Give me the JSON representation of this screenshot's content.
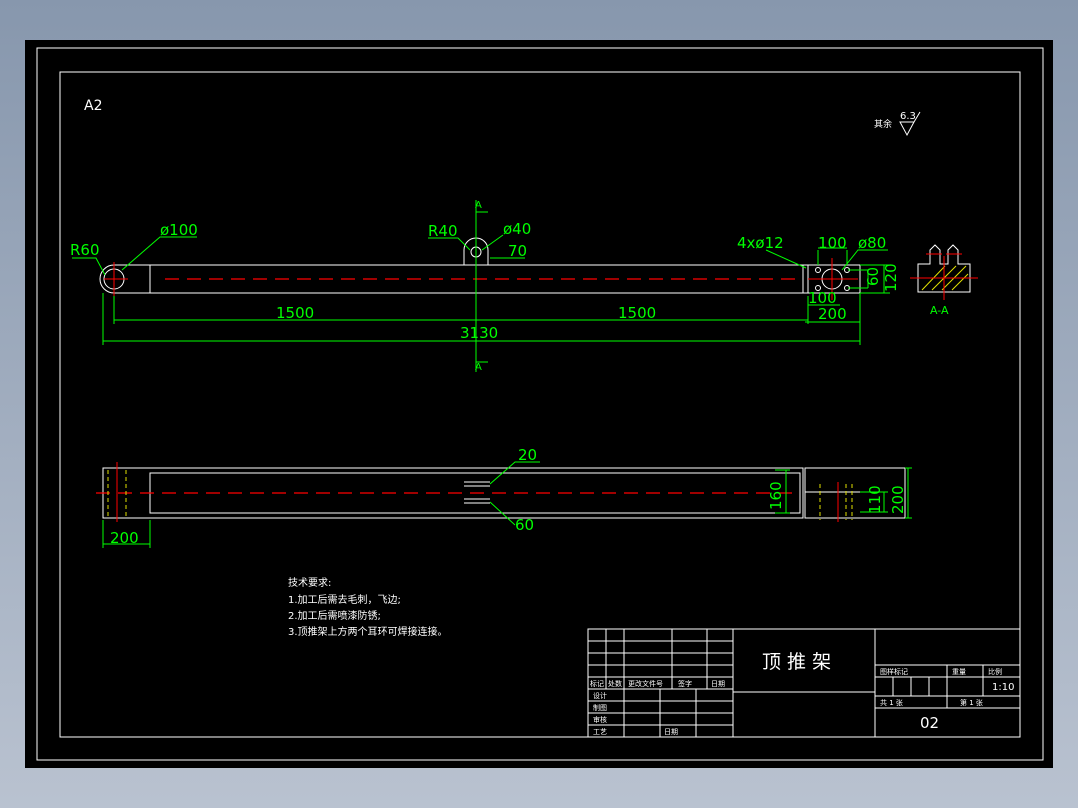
{
  "sheet": {
    "size_label": "A2",
    "roughness_label": "其余",
    "roughness_value": "6.3"
  },
  "top_view": {
    "dims": {
      "r60": "R60",
      "d100": "ø100",
      "r40": "R40",
      "d40": "ø40",
      "d70": "70",
      "holes": "4xø12",
      "d100b": "100",
      "d80": "ø80",
      "d60": "60",
      "d120": "120",
      "d100c": "100",
      "d200": "200",
      "l1500a": "1500",
      "l1500b": "1500",
      "l3130": "3130"
    },
    "section_marker": "A",
    "section_label": "A-A"
  },
  "bottom_view": {
    "dims": {
      "d20": "20",
      "d60": "60",
      "d160": "160",
      "d110": "110",
      "d200v": "200",
      "d200h": "200"
    }
  },
  "notes": {
    "title": "技术要求:",
    "items": [
      "1.加工后需去毛刺，飞边;",
      "2.加工后需喷漆防锈;",
      "3.顶推架上方两个耳环可焊接连接。"
    ]
  },
  "title_block": {
    "part_name": "顶 推 架",
    "drawing_no": "02",
    "scale": "1:10",
    "headers": {
      "mark": "标记",
      "count": "处数",
      "change_doc": "更改文件号",
      "sign": "签字",
      "date": "日期"
    },
    "roles": [
      "设计",
      "制图",
      "审核",
      "工艺"
    ],
    "date_label": "日期",
    "pattern_mark": "图样标记",
    "weight": "重量",
    "scale_label": "比例",
    "total_sheets": "共 1 张",
    "sheet_no": "第 1 张"
  }
}
